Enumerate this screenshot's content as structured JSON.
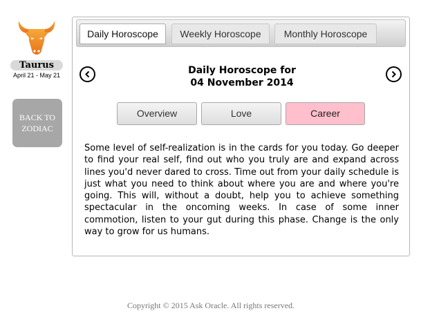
{
  "sign": {
    "icon": "taurus-bull-icon",
    "name": "Taurus",
    "dates": "April 21 - May 21"
  },
  "back_button": {
    "label": "BACK TO ZODIAC"
  },
  "tabs": [
    {
      "label": "Daily Horoscope",
      "active": true
    },
    {
      "label": "Weekly Horoscope",
      "active": false
    },
    {
      "label": "Monthly Horoscope",
      "active": false
    }
  ],
  "header": {
    "title_line1": "Daily Horoscope for",
    "title_line2": "04 November 2014",
    "prev_icon": "chevron-left-circle-icon",
    "next_icon": "chevron-right-circle-icon"
  },
  "categories": [
    {
      "label": "Overview",
      "active": false
    },
    {
      "label": "Love",
      "active": false
    },
    {
      "label": "Career",
      "active": true
    }
  ],
  "reading": "Some level of self-realization is in the cards for you today. Go deeper to find your real self, find out who you truly are and expand across lines you'd never dared to cross. Time out from your daily schedule is just what you need to think about where you are and where you're going. This will, without a doubt, help you to achieve something spectacular in the oncoming weeks. In case of some inner commotion, listen to your gut during this phase. Change is the only way to grow for us humans.",
  "footer": "Copyright © 2015 Ask Oracle. All rights reserved.",
  "colors": {
    "accent_active_category": "#ffbfcc",
    "icon_orange": "#f29a2e",
    "back_button_bg": "#a7a7a7"
  }
}
